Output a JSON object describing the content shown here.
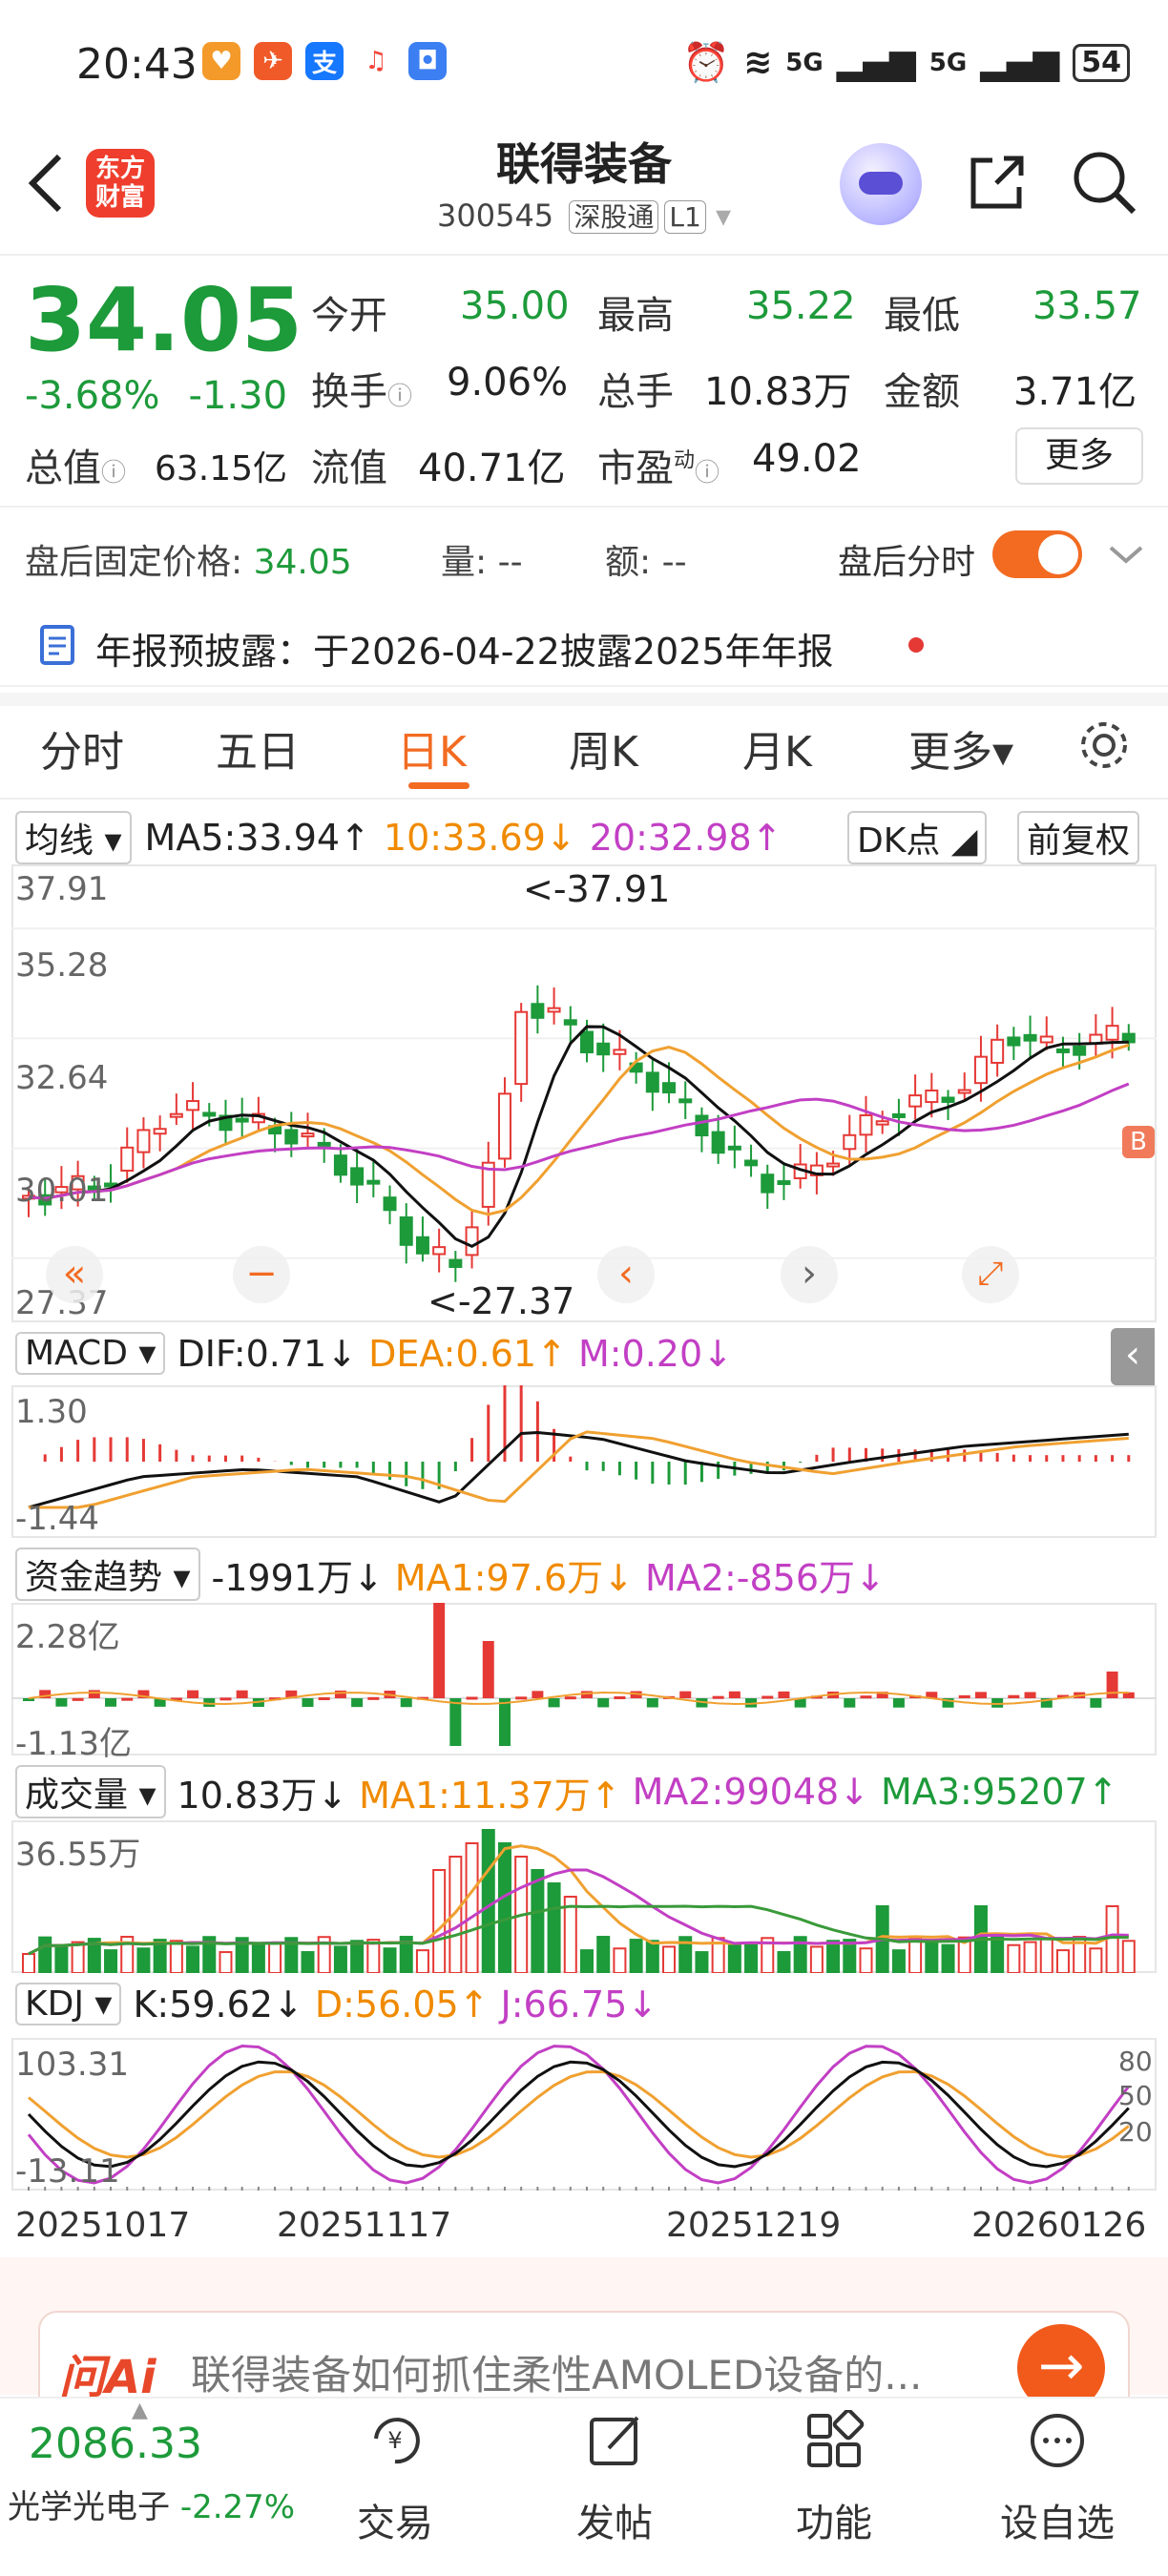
{
  "status_bar": {
    "time": "20:43",
    "battery": "54",
    "signal1": "5G",
    "signal2": "5G"
  },
  "header": {
    "logo_line1": "东方",
    "logo_line2": "财富",
    "title": "联得装备",
    "code": "300545",
    "exchange_tag": "深股通",
    "level_tag": "L1"
  },
  "quote": {
    "price": "34.05",
    "change_pct": "-3.68%",
    "change": "-1.30",
    "open_label": "今开",
    "open": "35.00",
    "high_label": "最高",
    "high": "35.22",
    "low_label": "最低",
    "low": "33.57",
    "turnover_label": "换手",
    "turnover": "9.06%",
    "volume_label": "总手",
    "volume": "10.83万",
    "amount_label": "金额",
    "amount": "3.71亿",
    "mktcap_label": "总值",
    "mktcap": "63.15亿",
    "float_label": "流值",
    "float": "40.71亿",
    "pe_label": "市盈",
    "pe_sup": "动",
    "pe": "49.02",
    "more": "更多"
  },
  "after_hours": {
    "label": "盘后固定价格:",
    "price": "34.05",
    "vol_label": "量:",
    "vol": "--",
    "amt_label": "额:",
    "amt": "--",
    "toggle_label": "盘后分时"
  },
  "announcement": {
    "text": "年报预披露：于2026-04-22披露2025年年报"
  },
  "tabs": [
    "分时",
    "五日",
    "日K",
    "周K",
    "月K",
    "更多▾"
  ],
  "active_tab": "日K",
  "kline": {
    "ma_chip": "均线",
    "ma5": "MA5:33.94↑",
    "ma10": "10:33.69↓",
    "ma20": "20:32.98↑",
    "dk_chip": "DK点",
    "adj_chip": "前复权",
    "y_labels": [
      "37.91",
      "35.28",
      "32.64",
      "30.01",
      "27.37"
    ],
    "max_note": "<-37.91",
    "min_note": "<-27.37",
    "b_marker": "B"
  },
  "macd": {
    "chip": "MACD",
    "dif": "DIF:0.71↓",
    "dea": "DEA:0.61↑",
    "m": "M:0.20↓",
    "y_top": "1.30",
    "y_bot": "-1.44"
  },
  "fund": {
    "chip": "资金趋势",
    "value": "-1991万↓",
    "ma1": "MA1:97.6万↓",
    "ma2": "MA2:-856万↓",
    "y_top": "2.28亿",
    "y_bot": "-1.13亿"
  },
  "vol": {
    "chip": "成交量",
    "value": "10.83万↓",
    "ma1": "MA1:11.37万↑",
    "ma2": "MA2:99048↓",
    "ma3": "MA3:95207↑",
    "y_top": "36.55万"
  },
  "kdj": {
    "chip": "KDJ",
    "k": "K:59.62↓",
    "d": "D:56.05↑",
    "j": "J:66.75↓",
    "y_top": "103.31",
    "y_bot": "-13.11",
    "r80": "80",
    "r50": "50",
    "r20": "20"
  },
  "dates": [
    "20251017",
    "20251117",
    "20251219",
    "20260126"
  ],
  "ai": {
    "logo": "问Ai",
    "prompt": "联得装备如何抓住柔性AMOLED设备的..."
  },
  "bottom": {
    "index_value": "2086.33",
    "index_name": "光学光电子",
    "index_change": "-2.27%",
    "nav": [
      "交易",
      "发帖",
      "功能",
      "设自选"
    ]
  },
  "colors": {
    "up": "#e53935",
    "down": "#1d9a3a",
    "accent": "#f26b21",
    "ma5": "#111111",
    "ma10": "#f0a030",
    "ma20": "#c23fc4"
  },
  "chart_data": {
    "type": "candlestick",
    "x_range": [
      "20251017",
      "20260126"
    ],
    "ylim": [
      27.37,
      37.91
    ],
    "max_label": 37.91,
    "min_label": 27.37
  }
}
